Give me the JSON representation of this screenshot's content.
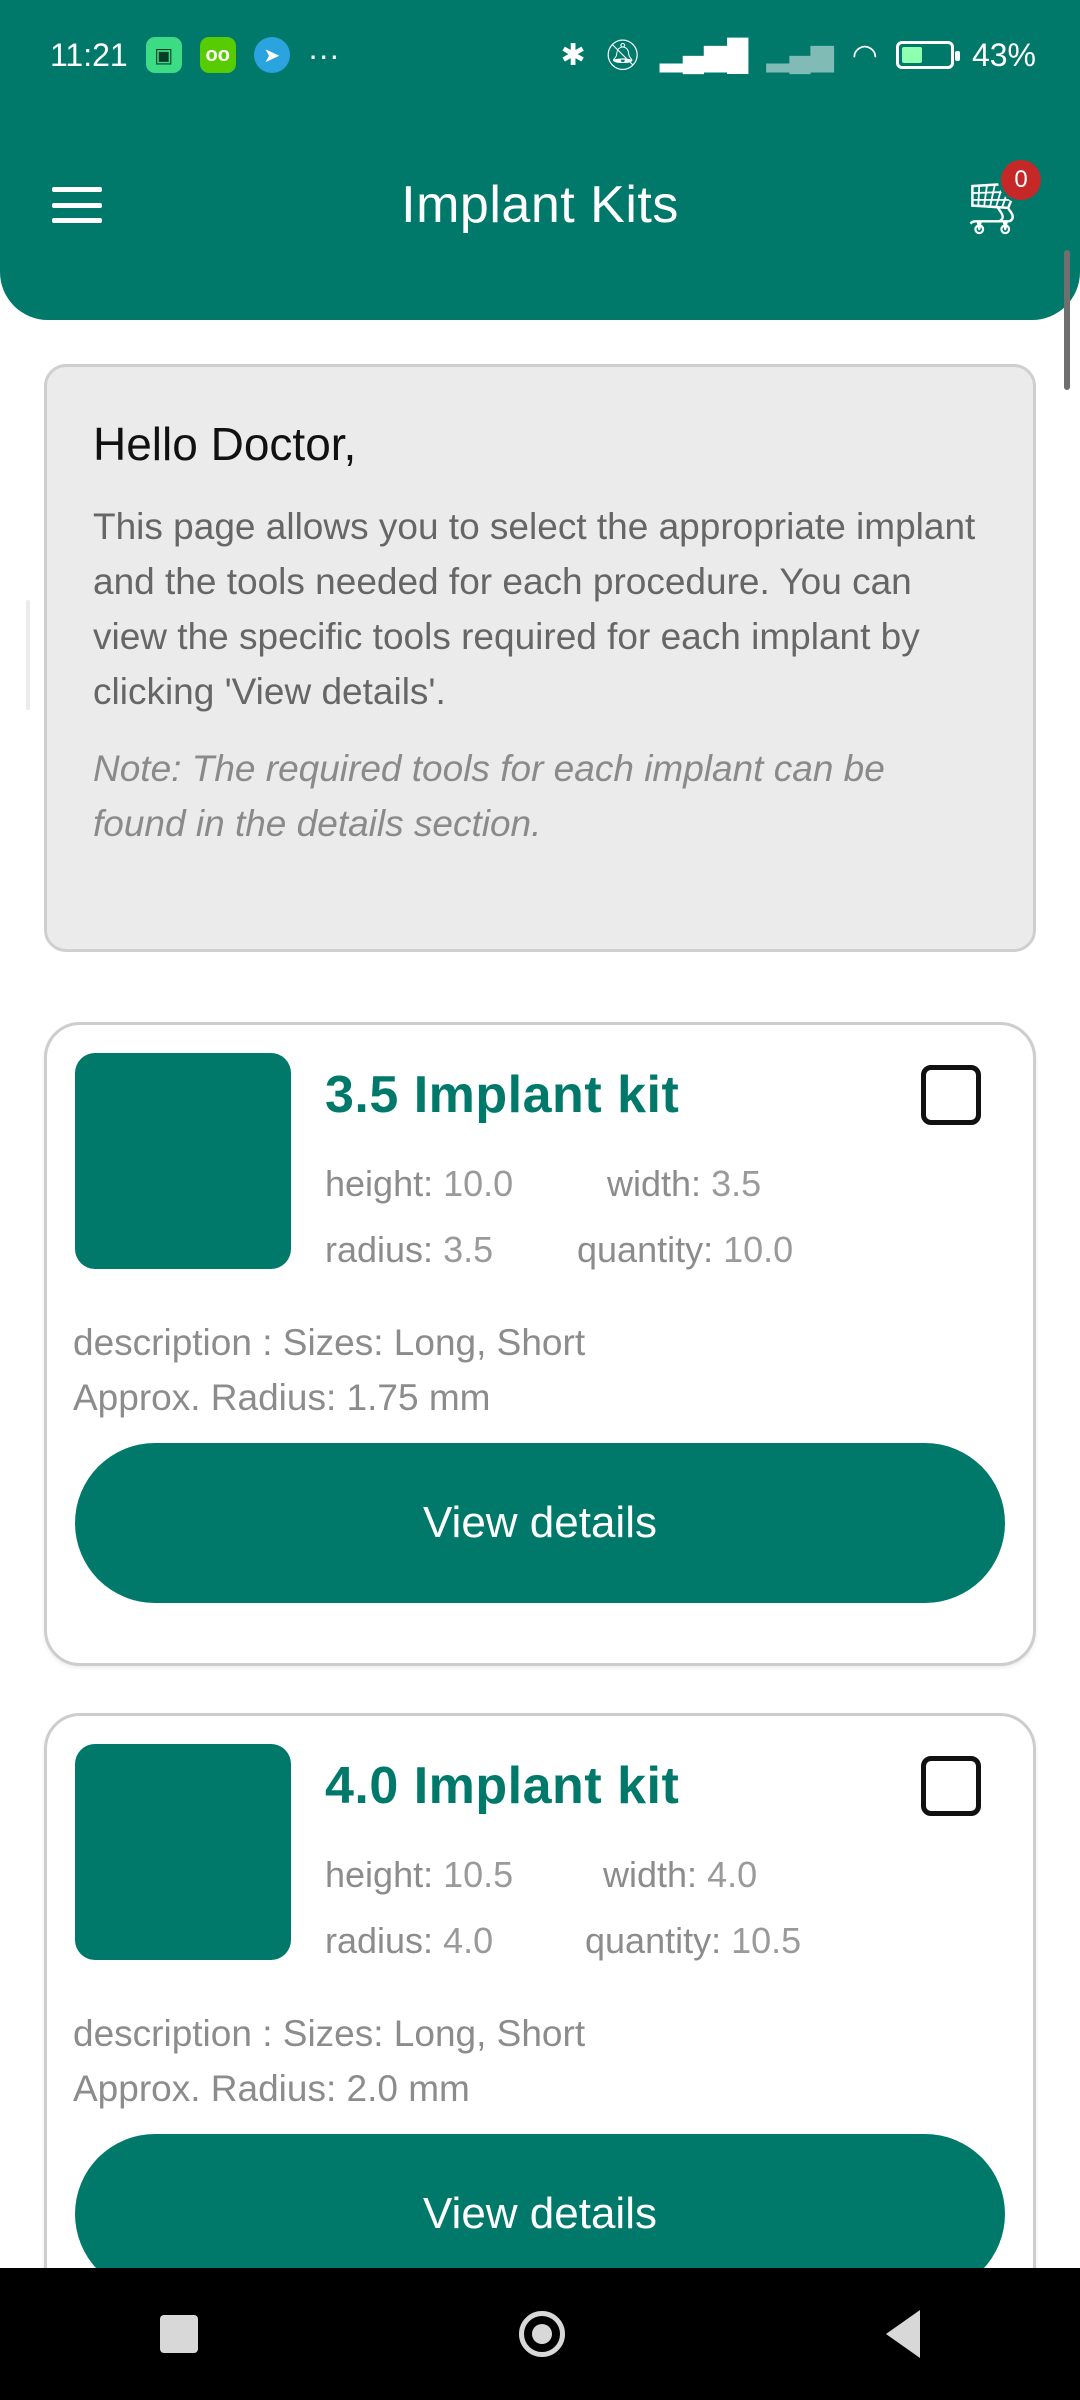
{
  "status_bar": {
    "time": "11:21",
    "more": "···",
    "battery_percent": "43%",
    "battery_level": 0.43,
    "icons": [
      "android-notification-icon",
      "duolingo-notification-icon",
      "telegram-notification-icon",
      "bluetooth-icon",
      "mute-icon",
      "signal-icon",
      "signal-weak-icon",
      "wifi-icon",
      "battery-charging-icon"
    ]
  },
  "header": {
    "title": "Implant Kits",
    "cart_count": "0"
  },
  "intro": {
    "greeting": "Hello Doctor,",
    "body": "This page allows you to select the appropriate implant and the tools needed for each procedure. You can view the specific tools required for each implant by clicking 'View details'.",
    "note": "Note: The required tools for each implant can be found in the details section."
  },
  "kits": [
    {
      "name": "3.5 Implant kit",
      "height_label": "height:",
      "height": "10.0",
      "width_label": "width:",
      "width": "3.5",
      "radius_label": "radius:",
      "radius": "3.5",
      "quantity_label": "quantity:",
      "quantity": "10.0",
      "description": " description : Sizes: Long, Short\nApprox. Radius: 1.75 mm",
      "button": "View details",
      "checked": false
    },
    {
      "name": "4.0 Implant kit",
      "height_label": "height:",
      "height": "10.5",
      "width_label": "width:",
      "width": "4.0",
      "radius_label": "radius:",
      "radius": "4.0",
      "quantity_label": "quantity:",
      "quantity": "10.5",
      "description": " description : Sizes: Long, Short\nApprox. Radius: 2.0 mm",
      "button": "View details",
      "checked": false
    }
  ],
  "colors": {
    "primary": "#00796b",
    "badge": "#c62828",
    "intro_background": "#ebebeb"
  }
}
